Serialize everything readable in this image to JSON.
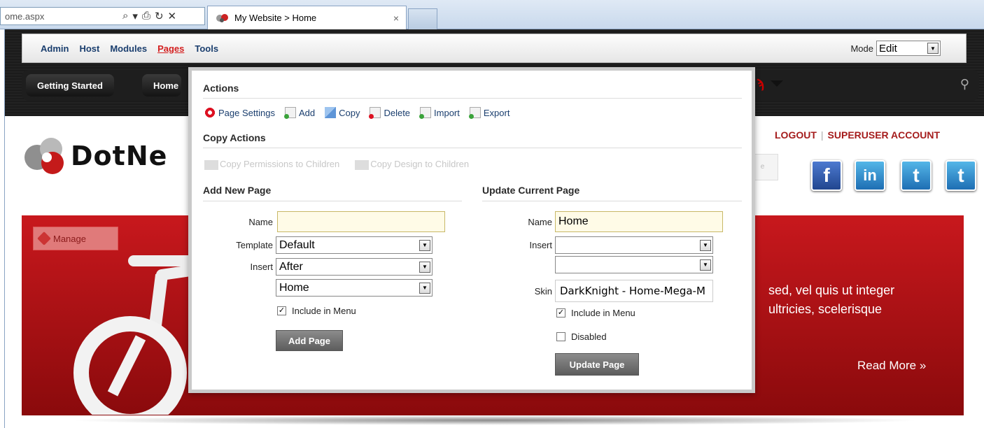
{
  "browser": {
    "address": "ome.aspx",
    "tab_title": "My Website > Home",
    "tab_close": "×",
    "addr_icons": [
      "⌕",
      "▾",
      "⎙",
      "↻",
      "✕"
    ]
  },
  "control_bar": {
    "menu": [
      "Admin",
      "Host",
      "Modules",
      "Pages",
      "Tools"
    ],
    "active_index": 3,
    "mode_label": "Mode",
    "mode_value": "Edit"
  },
  "nav": {
    "items": [
      "Getting Started",
      "Home"
    ]
  },
  "site": {
    "logo_text": "DotNe",
    "logout": "LOGOUT",
    "separator": "|",
    "account": "SUPERUSER ACCOUNT",
    "social": [
      "f",
      "in",
      "t",
      "t"
    ]
  },
  "banner": {
    "manage": "Manage",
    "text_line1": "sed, vel quis ut integer",
    "text_line2": "ultricies, scelerisque",
    "read_more": "Read More »"
  },
  "panel": {
    "actions_title": "Actions",
    "actions": [
      {
        "label": "Page Settings",
        "icon": "page-settings-icon"
      },
      {
        "label": "Add",
        "icon": "add-page-icon"
      },
      {
        "label": "Copy",
        "icon": "copy-page-icon"
      },
      {
        "label": "Delete",
        "icon": "delete-page-icon"
      },
      {
        "label": "Import",
        "icon": "import-page-icon"
      },
      {
        "label": "Export",
        "icon": "export-page-icon"
      }
    ],
    "copy_actions_title": "Copy Actions",
    "copy_actions": [
      "Copy Permissions to Children",
      "Copy Design to Children"
    ],
    "add_new": {
      "title": "Add New Page",
      "name_label": "Name",
      "name_value": "",
      "template_label": "Template",
      "template_value": "Default",
      "insert_label": "Insert",
      "insert_value": "After",
      "insert_page_value": "Home",
      "include_in_menu": "Include in Menu",
      "include_checked": true,
      "button": "Add Page"
    },
    "update_current": {
      "title": "Update Current Page",
      "name_label": "Name",
      "name_value": "Home",
      "insert_label": "Insert",
      "insert_value": "",
      "insert_page_value": "",
      "skin_label": "Skin",
      "skin_value": "DarkKnight - Home-Mega-M",
      "include_in_menu": "Include in Menu",
      "include_checked": true,
      "disabled": "Disabled",
      "disabled_checked": false,
      "button": "Update Page"
    }
  }
}
